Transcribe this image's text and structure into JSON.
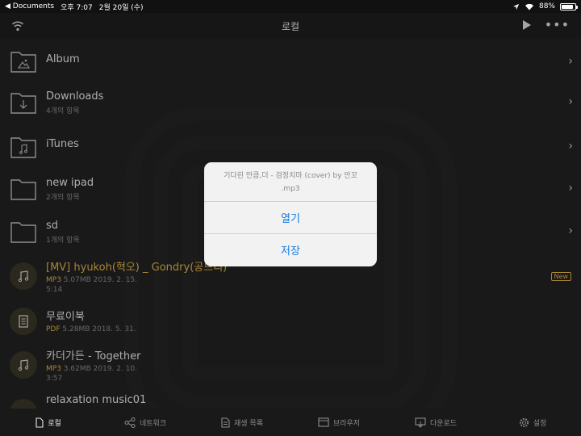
{
  "status_bar": {
    "back_app": "◀ Documents",
    "time": "오후 7:07",
    "date": "2월 20일 (수)",
    "battery": "88%",
    "battery_level": 0.88
  },
  "nav": {
    "title": "로컬"
  },
  "files": [
    {
      "name": "Album",
      "sub": "",
      "kind": "folder",
      "icon": "image-folder-icon"
    },
    {
      "name": "Downloads",
      "sub": "4개의 항목",
      "kind": "folder",
      "icon": "download-folder-icon"
    },
    {
      "name": "iTunes",
      "sub": "",
      "kind": "folder",
      "icon": "music-folder-icon"
    },
    {
      "name": "new ipad",
      "sub": "2개의 항목",
      "kind": "folder",
      "icon": "folder-icon"
    },
    {
      "name": "sd",
      "sub": "1개의 항목",
      "kind": "folder",
      "icon": "folder-icon"
    },
    {
      "name": "[MV] hyukoh(혁오) _ Gondry(공드리)",
      "type": "MP3",
      "meta": "5.07MB 2019. 2. 15.",
      "duration": "5:14",
      "badge": "New",
      "kind": "media"
    },
    {
      "name": "무료이북",
      "type": "PDF",
      "meta": "5.28MB 2018. 5. 31.",
      "kind": "doc"
    },
    {
      "name": "카더가든 - Together",
      "type": "MP3",
      "meta": "3.62MB 2019. 2. 10.",
      "duration": "3:57",
      "kind": "media"
    },
    {
      "name": "relaxation music01",
      "kind": "media"
    }
  ],
  "alert": {
    "message": "기다린 만큼,더 - 검정치마 (cover) by 안꼬 .mp3",
    "open_label": "열기",
    "save_label": "저장"
  },
  "tabs": [
    {
      "label": "로컬",
      "icon": "file-icon",
      "active": true
    },
    {
      "label": "네트워크",
      "icon": "share-icon"
    },
    {
      "label": "재생 목록",
      "icon": "playlist-icon"
    },
    {
      "label": "브라우저",
      "icon": "browser-icon"
    },
    {
      "label": "다운로드",
      "icon": "download-icon"
    },
    {
      "label": "설정",
      "icon": "gear-icon"
    }
  ],
  "colors": {
    "accent_blue": "#1a7de0",
    "file_type_gold": "#e0b34a",
    "background": "#222222"
  }
}
